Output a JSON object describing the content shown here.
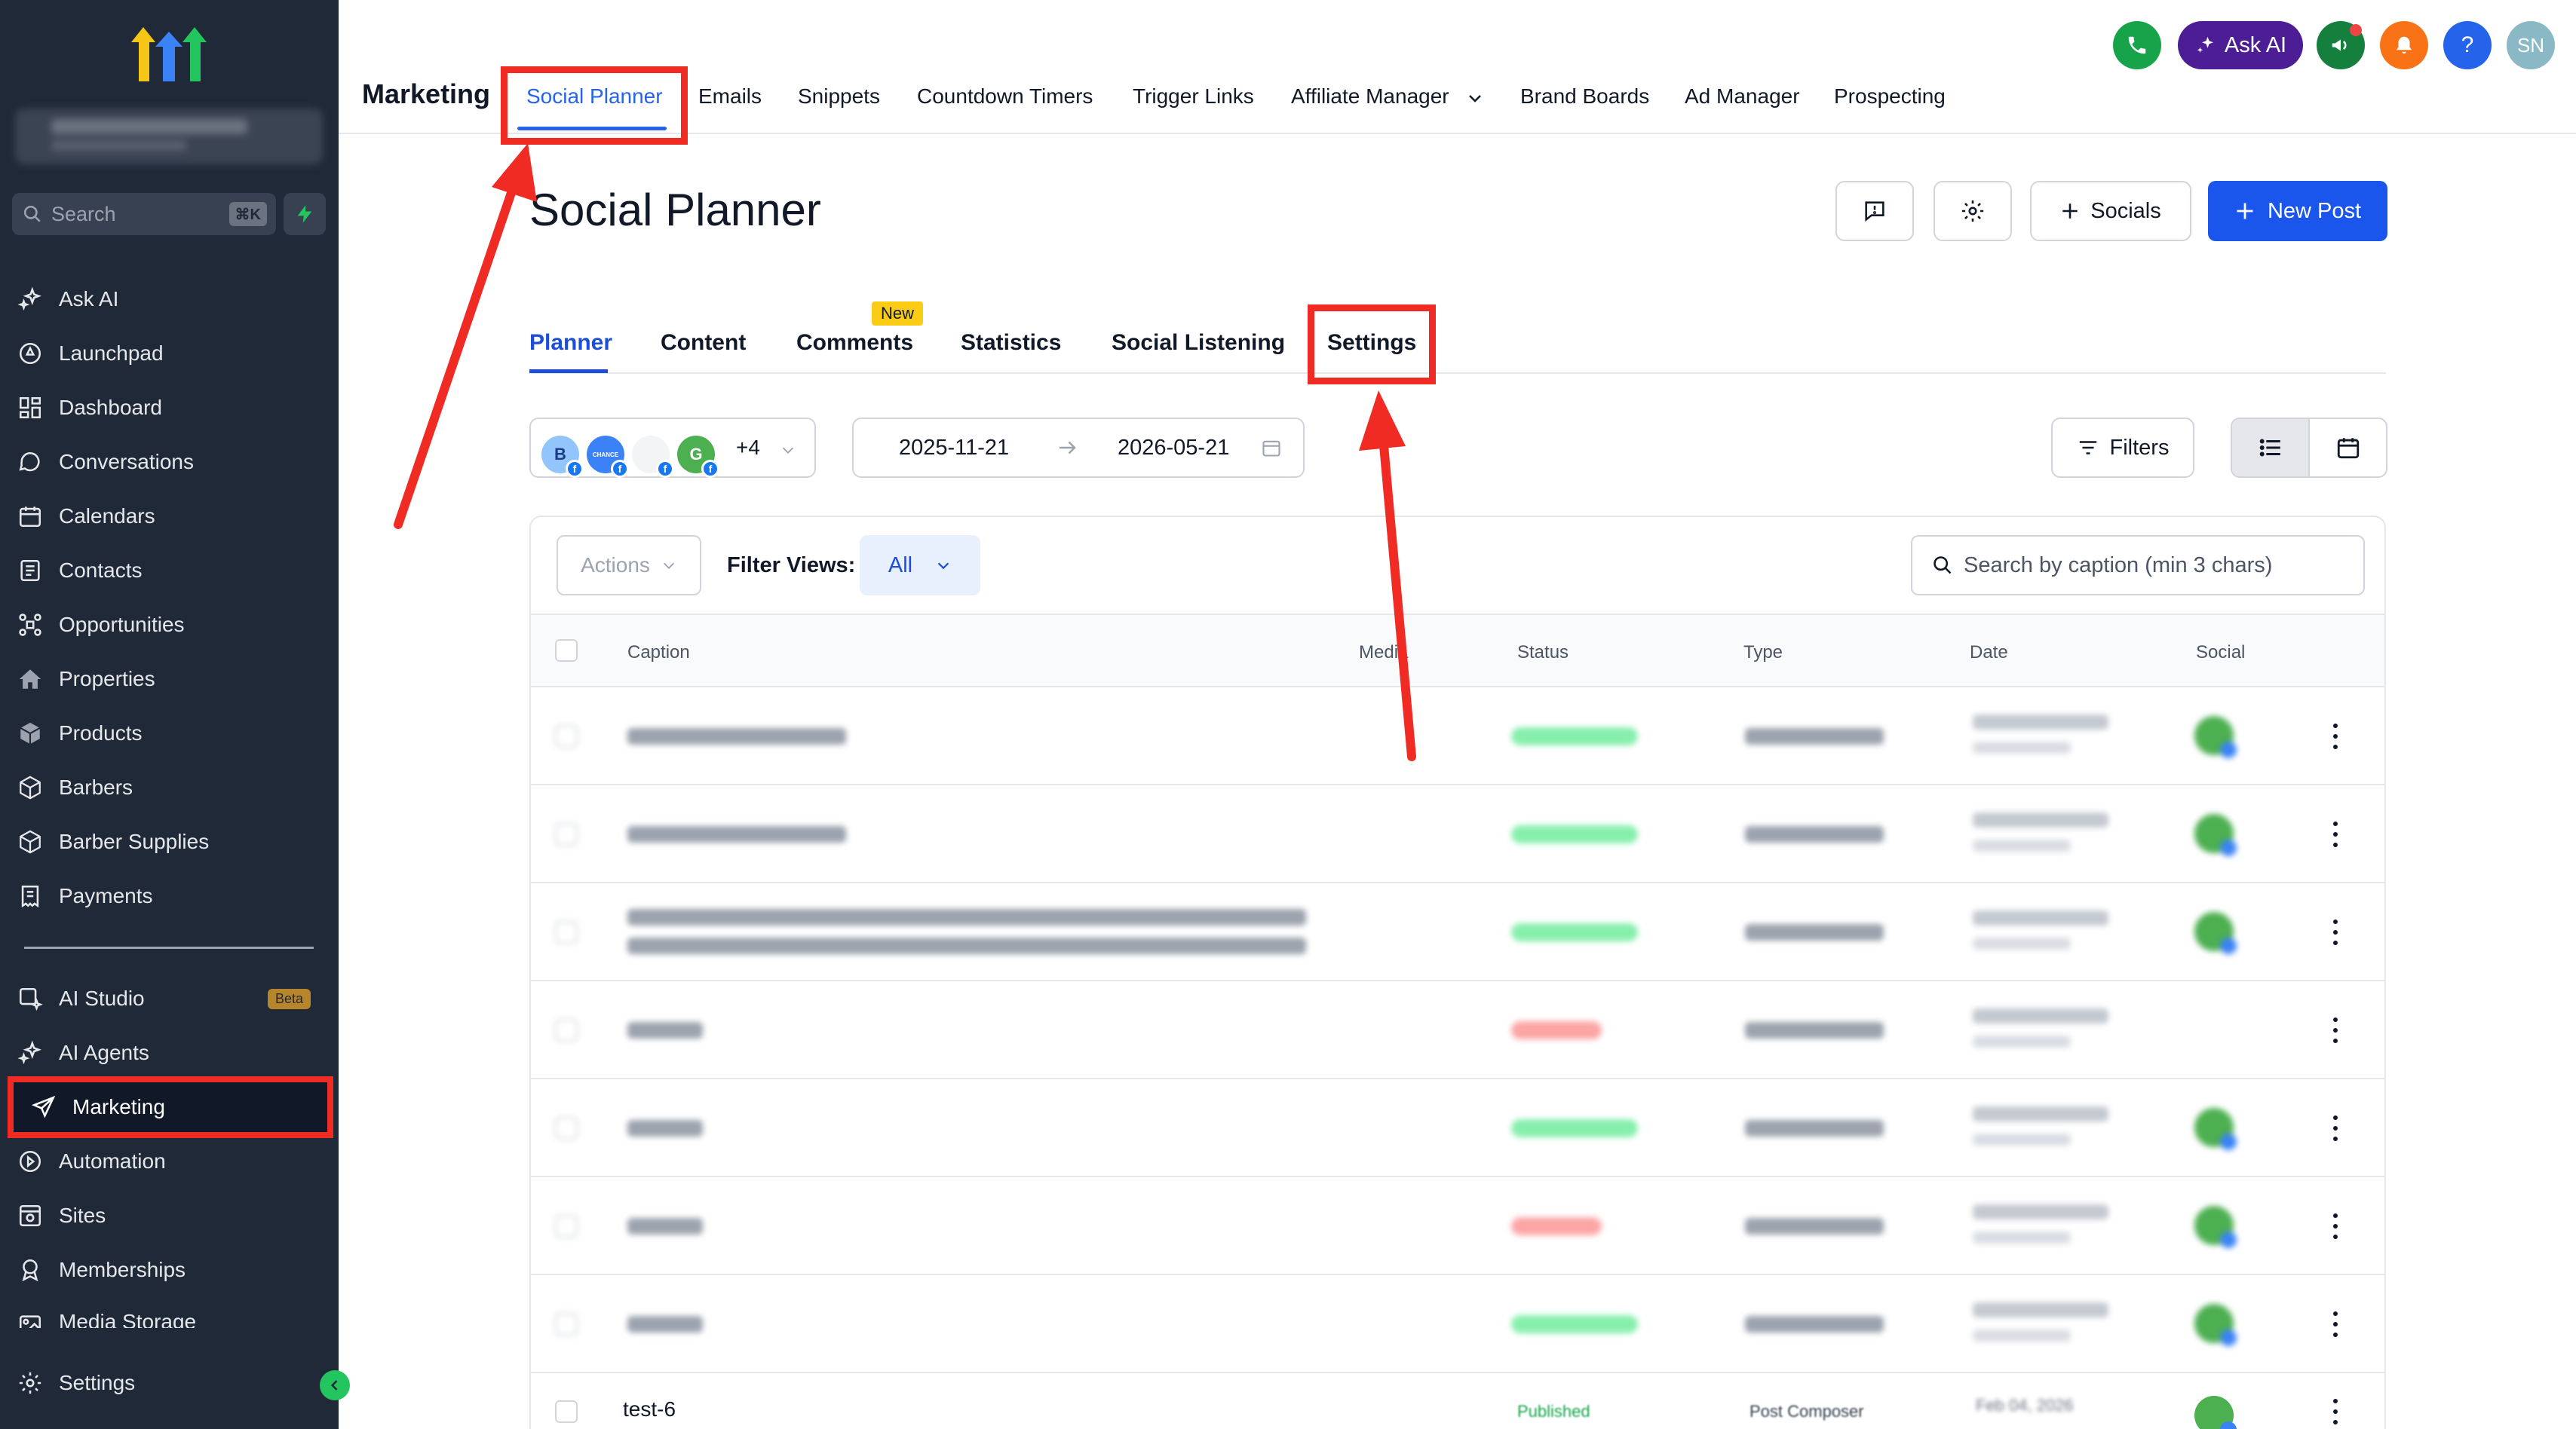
{
  "sidebar": {
    "search_label": "Search",
    "search_shortcut": "⌘K",
    "items": [
      {
        "label": "Ask AI",
        "icon": "sparkle-icon"
      },
      {
        "label": "Launchpad",
        "icon": "rocket-icon"
      },
      {
        "label": "Dashboard",
        "icon": "dashboard-icon"
      },
      {
        "label": "Conversations",
        "icon": "chat-icon"
      },
      {
        "label": "Calendars",
        "icon": "calendar-icon"
      },
      {
        "label": "Contacts",
        "icon": "contacts-icon"
      },
      {
        "label": "Opportunities",
        "icon": "opportunities-icon"
      },
      {
        "label": "Properties",
        "icon": "house-icon"
      },
      {
        "label": "Products",
        "icon": "box-icon"
      },
      {
        "label": "Barbers",
        "icon": "box-icon"
      },
      {
        "label": "Barber Supplies",
        "icon": "box-icon"
      },
      {
        "label": "Payments",
        "icon": "receipt-icon"
      }
    ],
    "items2": [
      {
        "label": "AI Studio",
        "icon": "ai-studio-icon",
        "badge": "Beta"
      },
      {
        "label": "AI Agents",
        "icon": "sparkle-icon"
      },
      {
        "label": "Marketing",
        "icon": "send-icon",
        "active": true
      },
      {
        "label": "Automation",
        "icon": "automation-icon"
      },
      {
        "label": "Sites",
        "icon": "sites-icon"
      },
      {
        "label": "Memberships",
        "icon": "badge-icon"
      },
      {
        "label": "Media Storage",
        "icon": "media-icon"
      }
    ],
    "settings_label": "Settings"
  },
  "header": {
    "section": "Marketing",
    "tabs": [
      "Social Planner",
      "Emails",
      "Snippets",
      "Countdown Timers",
      "Trigger Links",
      "Affiliate Manager",
      "Brand Boards",
      "Ad Manager",
      "Prospecting"
    ],
    "active_tab": "Social Planner",
    "ask_ai": "Ask AI",
    "help": "?",
    "avatar_initials": "SN"
  },
  "page": {
    "title": "Social Planner",
    "socials_label": "Socials",
    "new_post_label": "New Post",
    "subtabs": [
      "Planner",
      "Content",
      "Comments",
      "Statistics",
      "Social Listening",
      "Settings"
    ],
    "active_subtab": "Planner",
    "new_badge": "New",
    "accounts": [
      {
        "initial": "B",
        "bg": "#93c5fd"
      },
      {
        "initial": "CHANCE",
        "bg": "#3b82f6"
      },
      {
        "initial": "",
        "bg": "#e5e7eb"
      },
      {
        "initial": "G",
        "bg": "#4caf50"
      }
    ],
    "accounts_more": "+4",
    "date_from": "2025-11-21",
    "date_to": "2026-05-21",
    "filters_label": "Filters",
    "actions_label": "Actions",
    "filter_views_label": "Filter Views:",
    "filter_views_value": "All",
    "search_placeholder": "Search by caption (min 3 chars)",
    "columns": [
      "Caption",
      "Media",
      "Status",
      "Type",
      "Date",
      "Social"
    ],
    "last_row": {
      "caption": "test-6",
      "status": "Published",
      "type": "Post Composer",
      "date": "Feb 04, 2026"
    }
  },
  "colors": {
    "primary": "#1a56ec",
    "annotation": "#ef2b24",
    "sidebar": "#1f2937"
  }
}
